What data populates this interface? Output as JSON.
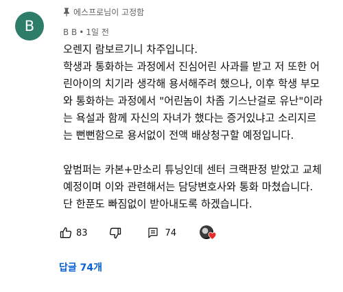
{
  "avatar": {
    "letter": "B",
    "color": "#2e7d68"
  },
  "pinned_label": "에스프로님이 고정함",
  "author": "B B",
  "time": "1일 전",
  "body_lines": [
    "오렌지 람보르기니 차주입니다.",
    "학생과 통화하는 과정에서 진심어린 사과를 받고 저 또한 어",
    "린아이의 치기라 생각해 용서해주려 했으나, 이후 학생 부모",
    "와 통화하는 과정에서 \"어린놈이 차좀 기스난걸로 유난\"이라",
    "는 욕설과 함께 자신의 자녀가 했다는 증거있냐고 소리지르",
    "는 뻔뻔함으로 용서없이 전액 배상청구할 예정입니다.",
    "",
    "앞범퍼는 카본+만소리 튜닝인데 센터 크랙판정 받았고 교체",
    "예정이며 이와 관련해서는 담당변호사와 통화 마쳤습니다.",
    "단 한푼도 빠짐없이 받아내도록 하겠습니다."
  ],
  "actions": {
    "like_icon": "thumbs-up-icon",
    "like_count": "83",
    "dislike_icon": "thumbs-down-icon",
    "reply_icon": "reply-icon",
    "reply_count": "74",
    "creator_heart_icon": "heart-icon",
    "heart_color": "#e52d27"
  },
  "replies_link": "답글 74개",
  "link_color": "#065fd4"
}
